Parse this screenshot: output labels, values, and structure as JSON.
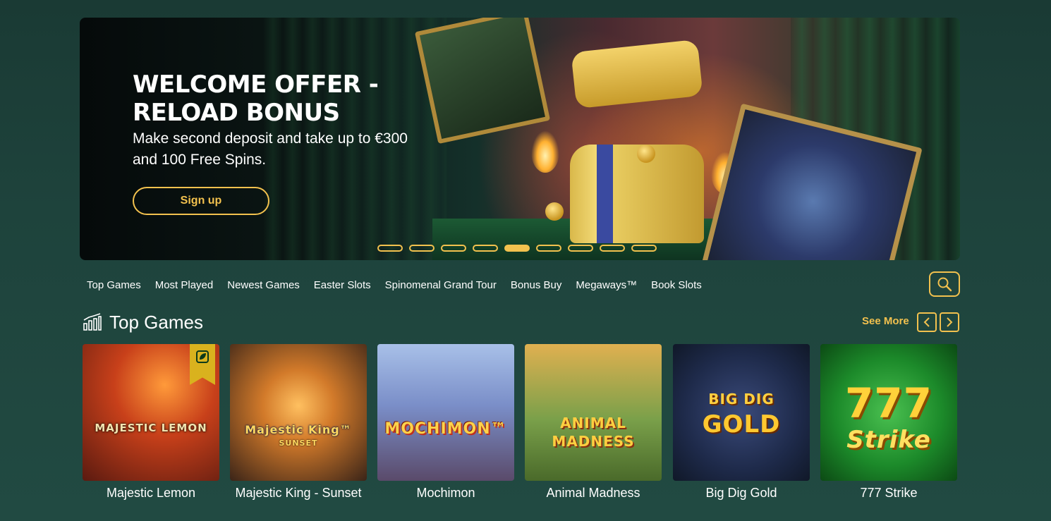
{
  "hero": {
    "title": "WELCOME OFFER - RELOAD BONUS",
    "subtitle": "Make second deposit and take up to €300 and 100 Free Spins.",
    "cta_label": "Sign up",
    "slide_count": 9,
    "active_slide": 5
  },
  "categories": [
    {
      "label": "Top Games"
    },
    {
      "label": "Most Played"
    },
    {
      "label": "Newest Games"
    },
    {
      "label": "Easter Slots"
    },
    {
      "label": "Spinomenal Grand Tour"
    },
    {
      "label": "Bonus Buy"
    },
    {
      "label": "Megaways™"
    },
    {
      "label": "Book Slots"
    }
  ],
  "section": {
    "title": "Top Games",
    "see_more": "See More"
  },
  "games": [
    {
      "name": "Majestic Lemon",
      "logo": "MAJESTIC LEMON",
      "has_badge": true
    },
    {
      "name": "Majestic King - Sunset",
      "logo": "Majestic King™",
      "logo2": "SUNSET"
    },
    {
      "name": "Mochimon",
      "logo": "MOCHIMON™"
    },
    {
      "name": "Animal Madness",
      "logo": "ANIMAL",
      "logo2": "MADNESS"
    },
    {
      "name": "Big Dig Gold",
      "logo": "BIG DIG",
      "logo2": "GOLD"
    },
    {
      "name": "777 Strike",
      "logo": "777",
      "logo2": "Strike"
    }
  ],
  "colors": {
    "accent": "#f2c14e",
    "background": "#1e433c"
  },
  "icons": {
    "search": "search-icon",
    "section": "bar-chart-icon",
    "prev": "chevron-left-icon",
    "next": "chevron-right-icon"
  }
}
